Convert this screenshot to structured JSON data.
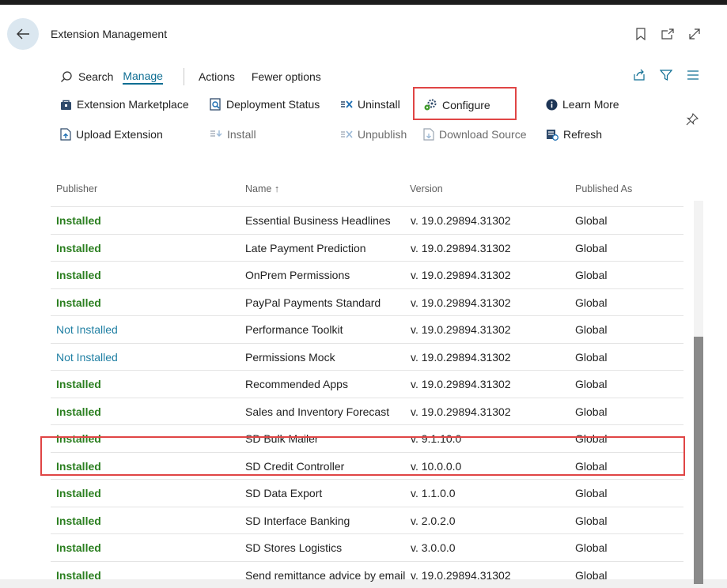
{
  "header": {
    "title": "Extension Management"
  },
  "menu": {
    "search": "Search",
    "manage": "Manage",
    "actions": "Actions",
    "fewer": "Fewer options"
  },
  "actions": {
    "marketplace": "Extension Marketplace",
    "deployment": "Deployment Status",
    "uninstall": "Uninstall",
    "configure": "Configure",
    "learn_more": "Learn More",
    "upload": "Upload Extension",
    "install": "Install",
    "unpublish": "Unpublish",
    "download": "Download Source",
    "refresh": "Refresh"
  },
  "table": {
    "columns": [
      "Publisher",
      "Name ↑",
      "Version",
      "Published As"
    ],
    "rows": [
      {
        "status": "Installed",
        "name": "Essential Business Headlines",
        "version": "v. 19.0.29894.31302",
        "published": "Global"
      },
      {
        "status": "Installed",
        "name": "Late Payment Prediction",
        "version": "v. 19.0.29894.31302",
        "published": "Global"
      },
      {
        "status": "Installed",
        "name": "OnPrem Permissions",
        "version": "v. 19.0.29894.31302",
        "published": "Global"
      },
      {
        "status": "Installed",
        "name": "PayPal Payments Standard",
        "version": "v. 19.0.29894.31302",
        "published": "Global"
      },
      {
        "status": "Not Installed",
        "name": "Performance Toolkit",
        "version": "v. 19.0.29894.31302",
        "published": "Global"
      },
      {
        "status": "Not Installed",
        "name": "Permissions Mock",
        "version": "v. 19.0.29894.31302",
        "published": "Global"
      },
      {
        "status": "Installed",
        "name": "Recommended Apps",
        "version": "v. 19.0.29894.31302",
        "published": "Global"
      },
      {
        "status": "Installed",
        "name": "Sales and Inventory Forecast",
        "version": "v. 19.0.29894.31302",
        "published": "Global"
      },
      {
        "status": "Installed",
        "name": "SD Bulk Mailer",
        "version": "v. 9.1.10.0",
        "published": "Global"
      },
      {
        "status": "Installed",
        "name": "SD Credit Controller",
        "version": "v. 10.0.0.0",
        "published": "Global"
      },
      {
        "status": "Installed",
        "name": "SD Data Export",
        "version": "v. 1.1.0.0",
        "published": "Global"
      },
      {
        "status": "Installed",
        "name": "SD Interface Banking",
        "version": "v. 2.0.2.0",
        "published": "Global"
      },
      {
        "status": "Installed",
        "name": "SD Stores Logistics",
        "version": "v. 3.0.0.0",
        "published": "Global"
      },
      {
        "status": "Installed",
        "name": "Send remittance advice by email",
        "version": "v. 19.0.29894.31302",
        "published": "Global"
      }
    ]
  },
  "colors": {
    "accent": "#0f6e93",
    "installed": "#2a7e1f",
    "not_installed": "#1f7fa3",
    "highlight": "#e04545"
  }
}
